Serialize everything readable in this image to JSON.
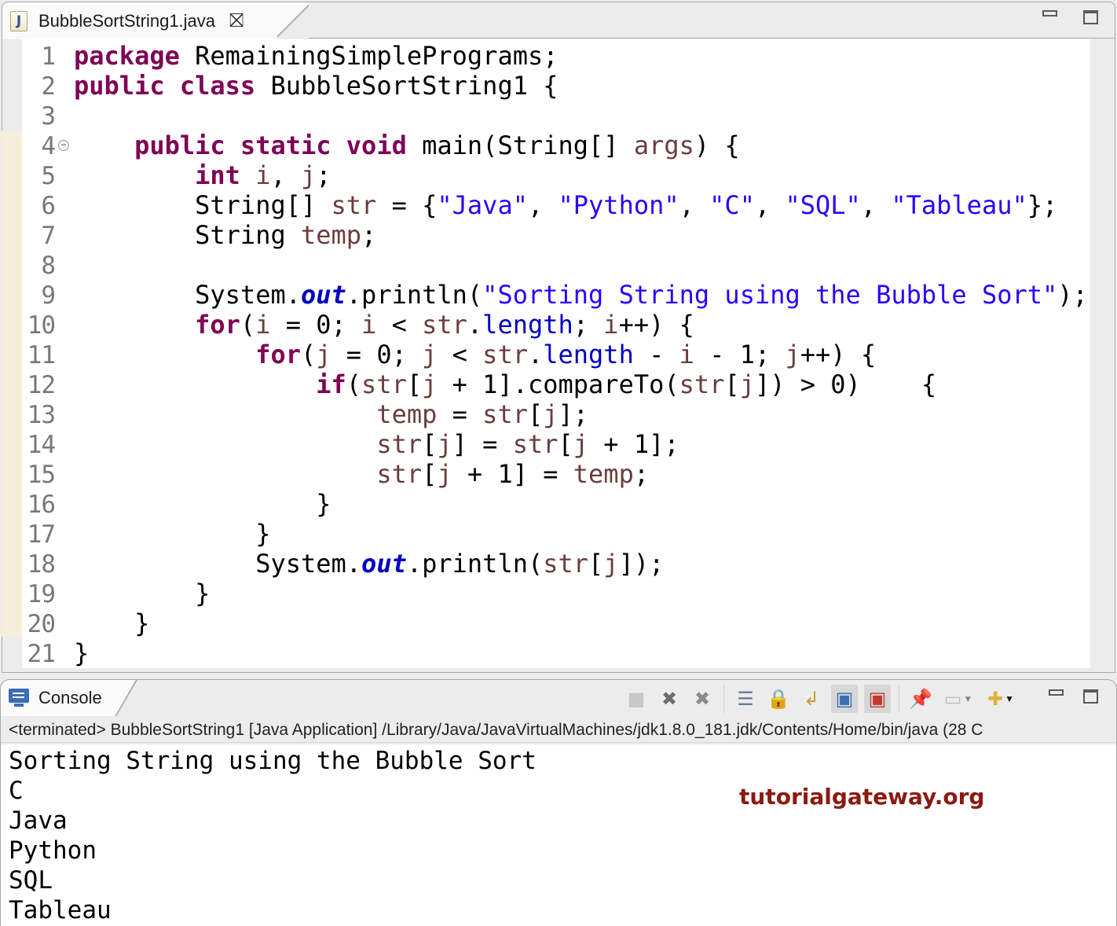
{
  "editor": {
    "tab_title": "BubbleSortString1.java",
    "file_icon": "java-file-icon",
    "close_icon": "close-icon",
    "controls": [
      "minimize-icon",
      "maximize-icon"
    ],
    "lines": [
      {
        "n": "1",
        "tokens": [
          [
            "kw",
            "package"
          ],
          [
            "",
            "  RemainingSimplePrograms;"
          ]
        ]
      },
      {
        "n": "2",
        "tokens": [
          [
            "kw",
            "public class"
          ],
          [
            "",
            "  BubbleSortString1 {"
          ]
        ]
      },
      {
        "n": "3",
        "tokens": []
      },
      {
        "n": "4",
        "fold": true,
        "tokens": [
          [
            "",
            "    "
          ],
          [
            "kw",
            "public static void"
          ],
          [
            "",
            " main(String[] "
          ],
          [
            "var",
            "args"
          ],
          [
            "",
            " ) {"
          ]
        ]
      },
      {
        "n": "5",
        "tokens": [
          [
            "",
            "        "
          ],
          [
            "kw",
            "int"
          ],
          [
            "",
            " "
          ],
          [
            "var",
            "i"
          ],
          [
            "",
            " , "
          ],
          [
            "var",
            "j"
          ],
          [
            "",
            " ;"
          ]
        ]
      },
      {
        "n": "6",
        "tokens": [
          [
            "",
            "        String[] "
          ],
          [
            "var",
            "str"
          ],
          [
            "",
            " = {"
          ],
          [
            "str",
            "\"Java\""
          ],
          [
            "",
            ", "
          ],
          [
            "str",
            "\"Python\""
          ],
          [
            "",
            ", "
          ],
          [
            "str",
            "\"C\""
          ],
          [
            "",
            ", "
          ],
          [
            "str",
            "\"SQL\""
          ],
          [
            "",
            ", "
          ],
          [
            "str",
            "\"Tableau\""
          ],
          [
            "",
            "};"
          ]
        ]
      },
      {
        "n": "7",
        "tokens": [
          [
            "",
            "        String "
          ],
          [
            "var",
            "temp"
          ],
          [
            "",
            ";"
          ]
        ]
      },
      {
        "n": "8",
        "tokens": []
      },
      {
        "n": "9",
        "tokens": [
          [
            "",
            "        System."
          ],
          [
            "sfld",
            "out"
          ],
          [
            "",
            ".println("
          ],
          [
            "str",
            "\"Sorting String using the Bubble Sort\""
          ],
          [
            "",
            ");"
          ]
        ]
      },
      {
        "n": "10",
        "tokens": [
          [
            "",
            "        "
          ],
          [
            "kw",
            "for"
          ],
          [
            "",
            "("
          ],
          [
            "var",
            "i"
          ],
          [
            "",
            " = 0; "
          ],
          [
            "var",
            "i"
          ],
          [
            "",
            " < "
          ],
          [
            "var",
            "str"
          ],
          [
            "",
            "."
          ],
          [
            "fld",
            "length"
          ],
          [
            "",
            "; "
          ],
          [
            "var",
            "i"
          ],
          [
            "",
            "++) {"
          ]
        ]
      },
      {
        "n": "11",
        "tokens": [
          [
            "",
            "            "
          ],
          [
            "kw",
            "for"
          ],
          [
            "",
            "("
          ],
          [
            "var",
            "j"
          ],
          [
            "",
            " = 0; "
          ],
          [
            "var",
            "j"
          ],
          [
            "",
            " < "
          ],
          [
            "var",
            "str"
          ],
          [
            "",
            "."
          ],
          [
            "fld",
            "length"
          ],
          [
            "",
            " - "
          ],
          [
            "var",
            "i"
          ],
          [
            "",
            " - 1; "
          ],
          [
            "var",
            "j"
          ],
          [
            "",
            "++) {"
          ]
        ]
      },
      {
        "n": "12",
        "tokens": [
          [
            "",
            "                "
          ],
          [
            "kw",
            "if"
          ],
          [
            "",
            "("
          ],
          [
            "var",
            "str"
          ],
          [
            "",
            "["
          ],
          [
            "var",
            "j"
          ],
          [
            "",
            " + 1].compareTo("
          ],
          [
            "var",
            "str"
          ],
          [
            "",
            "["
          ],
          [
            "var",
            "j"
          ],
          [
            "",
            "]) > 0)    {"
          ]
        ]
      },
      {
        "n": "13",
        "tokens": [
          [
            "",
            "                    "
          ],
          [
            "var",
            "temp"
          ],
          [
            "",
            " = "
          ],
          [
            "var",
            "str"
          ],
          [
            "",
            "["
          ],
          [
            "var",
            "j"
          ],
          [
            "",
            "];"
          ]
        ]
      },
      {
        "n": "14",
        "tokens": [
          [
            "",
            "                    "
          ],
          [
            "var",
            "str"
          ],
          [
            "",
            "["
          ],
          [
            "var",
            "j"
          ],
          [
            "",
            "] = "
          ],
          [
            "var",
            "str"
          ],
          [
            "",
            "["
          ],
          [
            "var",
            "j"
          ],
          [
            "",
            " + 1];"
          ]
        ]
      },
      {
        "n": "15",
        "tokens": [
          [
            "",
            "                    "
          ],
          [
            "var",
            "str"
          ],
          [
            "",
            "["
          ],
          [
            "var",
            "j"
          ],
          [
            "",
            " + 1] = "
          ],
          [
            "var",
            "temp"
          ],
          [
            "",
            ";"
          ]
        ]
      },
      {
        "n": "16",
        "tokens": [
          [
            "",
            "                }"
          ]
        ]
      },
      {
        "n": "17",
        "tokens": [
          [
            "",
            "            }"
          ]
        ]
      },
      {
        "n": "18",
        "tokens": [
          [
            "",
            "            System."
          ],
          [
            "sfld",
            "out"
          ],
          [
            "",
            ".println("
          ],
          [
            "var",
            "str"
          ],
          [
            "",
            "["
          ],
          [
            "var",
            "j"
          ],
          [
            "",
            "]);"
          ]
        ]
      },
      {
        "n": "19",
        "tokens": [
          [
            "",
            "        }"
          ]
        ]
      },
      {
        "n": "20",
        "tokens": [
          [
            "",
            "    }"
          ]
        ]
      },
      {
        "n": "21",
        "tokens": [
          [
            "",
            "}"
          ]
        ]
      }
    ]
  },
  "console": {
    "tab_title": "Console",
    "status": "<terminated> BubbleSortString1 [Java Application] /Library/Java/JavaVirtualMachines/jdk1.8.0_181.jdk/Contents/Home/bin/java  (28 C",
    "toolbar": [
      {
        "name": "terminate-icon",
        "glyph": "■",
        "color": "#c8c8c8",
        "disabled": true
      },
      {
        "name": "remove-launch-icon",
        "glyph": "✖",
        "color": "#6d6d6d"
      },
      {
        "name": "remove-all-terminated-icon",
        "glyph": "✖",
        "color": "#8a8a8a"
      },
      {
        "sep": true
      },
      {
        "name": "clear-console-icon",
        "glyph": "☰",
        "color": "#6a7a95"
      },
      {
        "name": "scroll-lock-icon",
        "glyph": "🔒",
        "color": "#c89a2a"
      },
      {
        "name": "word-wrap-icon",
        "glyph": "↲",
        "color": "#c8a030"
      },
      {
        "name": "show-console-on-stdout-icon",
        "glyph": "▣",
        "color": "#3a6db5",
        "pressed": true
      },
      {
        "name": "show-console-on-stderr-icon",
        "glyph": "▣",
        "color": "#c0392b",
        "pressed": true
      },
      {
        "sep": true
      },
      {
        "name": "pin-console-icon",
        "glyph": "📌",
        "color": "#2e9e3e"
      },
      {
        "name": "display-selected-console-icon",
        "glyph": "▭",
        "color": "#bdbdbd",
        "dropdown": true
      },
      {
        "name": "open-console-icon",
        "glyph": "✚",
        "color": "#e0b040",
        "dropdown": true,
        "dark": true
      }
    ],
    "output": [
      "Sorting String using the Bubble Sort",
      "C",
      "Java",
      "Python",
      "SQL",
      "Tableau"
    ],
    "watermark": "tutorialgateway.org"
  }
}
